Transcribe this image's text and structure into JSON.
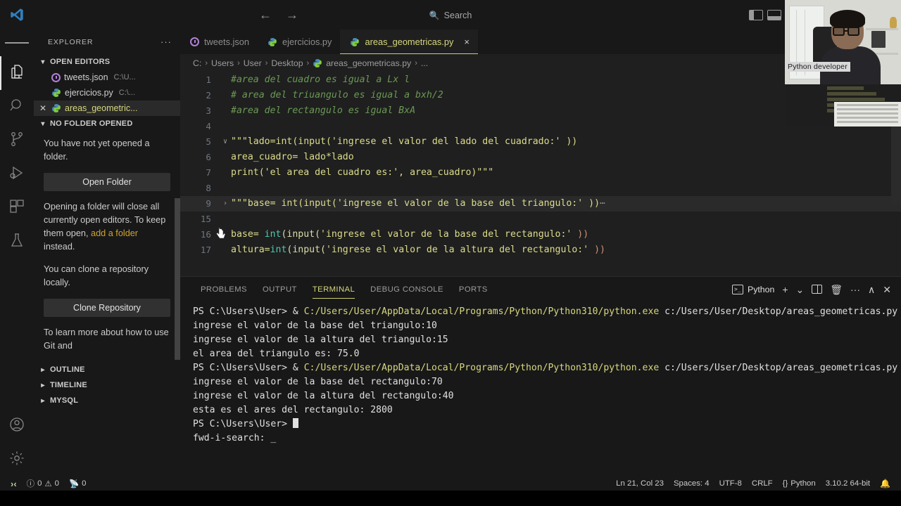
{
  "titlebar": {
    "back_label": "←",
    "forward_label": "→",
    "search_placeholder": "Search",
    "search_icon": "search-icon"
  },
  "activitybar": {
    "items": [
      {
        "name": "explorer",
        "icon": "files-icon",
        "active": true
      },
      {
        "name": "search",
        "icon": "search-icon",
        "active": false
      },
      {
        "name": "source-control",
        "icon": "source-control-icon",
        "active": false
      },
      {
        "name": "run-and-debug",
        "icon": "run-debug-icon",
        "active": false
      },
      {
        "name": "extensions",
        "icon": "extensions-icon",
        "active": false
      },
      {
        "name": "testing",
        "icon": "beaker-icon",
        "active": false
      }
    ],
    "bottom": [
      {
        "name": "accounts",
        "icon": "account-icon"
      },
      {
        "name": "settings",
        "icon": "gear-icon"
      }
    ]
  },
  "sidebar": {
    "title": "EXPLORER",
    "more_actions": "···",
    "open_editors": {
      "label": "OPEN EDITORS",
      "files": [
        {
          "name": "tweets.json",
          "path": "C:\\U...",
          "icon": "json-icon",
          "active": false
        },
        {
          "name": "ejercicios.py",
          "path": "C:\\...",
          "icon": "python-icon",
          "active": false
        },
        {
          "name": "areas_geometric...",
          "path": "",
          "icon": "python-icon",
          "active": true
        }
      ]
    },
    "no_folder": {
      "label": "NO FOLDER OPENED",
      "message_1": "You have not yet opened a folder.",
      "open_folder_button": "Open Folder",
      "message_2_pre": "Opening a folder will close all currently open editors. To keep them open, ",
      "message_2_link": "add a folder",
      "message_2_post": " instead.",
      "message_3": "You can clone a repository locally.",
      "clone_button": "Clone Repository",
      "message_4": "To learn more about how to use Git and"
    },
    "sections": [
      {
        "label": "OUTLINE"
      },
      {
        "label": "TIMELINE"
      },
      {
        "label": "MYSQL"
      }
    ]
  },
  "editor": {
    "tabs": [
      {
        "label": "tweets.json",
        "icon": "json-icon",
        "active": false,
        "closable": false
      },
      {
        "label": "ejercicios.py",
        "icon": "python-icon",
        "active": false,
        "closable": false
      },
      {
        "label": "areas_geometricas.py",
        "icon": "python-icon",
        "active": true,
        "closable": true,
        "close_label": "×"
      }
    ],
    "breadcrumb": [
      "C:",
      "Users",
      "User",
      "Desktop",
      "areas_geometricas.py",
      "..."
    ],
    "lines": [
      {
        "num": "1",
        "fold": "",
        "highlight": false,
        "tokens": [
          {
            "t": "#area del cuadro es igual a Lx l",
            "c": "cm"
          }
        ]
      },
      {
        "num": "2",
        "fold": "",
        "highlight": false,
        "tokens": [
          {
            "t": "# area del triuangulo es igual a bxh/2",
            "c": "cm"
          }
        ]
      },
      {
        "num": "3",
        "fold": "",
        "highlight": false,
        "tokens": [
          {
            "t": "#area del rectangulo es igual BxA",
            "c": "cm"
          }
        ]
      },
      {
        "num": "4",
        "fold": "",
        "highlight": false,
        "tokens": [
          {
            "t": "",
            "c": ""
          }
        ]
      },
      {
        "num": "5",
        "fold": "∨",
        "highlight": false,
        "tokens": [
          {
            "t": "\"\"\"lado=int(input('ingrese el valor del lado del cuadrado:' ))",
            "c": "yel"
          }
        ]
      },
      {
        "num": "6",
        "fold": "",
        "highlight": false,
        "tokens": [
          {
            "t": "area_cuadro= lado*lado",
            "c": "yel"
          }
        ]
      },
      {
        "num": "7",
        "fold": "",
        "highlight": false,
        "tokens": [
          {
            "t": "print('el area del cuadro es:', area_cuadro)\"\"\"",
            "c": "yel"
          }
        ]
      },
      {
        "num": "8",
        "fold": "",
        "highlight": false,
        "tokens": [
          {
            "t": "",
            "c": ""
          }
        ]
      },
      {
        "num": "9",
        "fold": "›",
        "highlight": true,
        "tokens": [
          {
            "t": "\"\"\"base= int(input('ingrese el valor de la base del triangulo:' ))",
            "c": "yel"
          },
          {
            "t": "⋯",
            "c": "dots3"
          }
        ]
      },
      {
        "num": "15",
        "fold": "",
        "highlight": false,
        "tokens": [
          {
            "t": "",
            "c": ""
          }
        ]
      },
      {
        "num": "16",
        "fold": "",
        "highlight": false,
        "tokens": [
          {
            "t": "base= ",
            "c": "yel"
          },
          {
            "t": "int",
            "c": "kw"
          },
          {
            "t": "(input(",
            "c": "pl"
          },
          {
            "t": "'ingrese el valor de la base del rectangulo:'",
            "c": "yel"
          },
          {
            "t": " ))",
            "c": "str"
          }
        ]
      },
      {
        "num": "17",
        "fold": "",
        "highlight": false,
        "tokens": [
          {
            "t": "altura=",
            "c": "yel"
          },
          {
            "t": "int",
            "c": "kw"
          },
          {
            "t": "(input(",
            "c": "pl"
          },
          {
            "t": "'ingrese el valor de la altura del rectangulo:'",
            "c": "yel"
          },
          {
            "t": " ))",
            "c": "str"
          }
        ]
      }
    ]
  },
  "panel": {
    "tabs": [
      {
        "label": "PROBLEMS",
        "active": false
      },
      {
        "label": "OUTPUT",
        "active": false
      },
      {
        "label": "TERMINAL",
        "active": true
      },
      {
        "label": "DEBUG CONSOLE",
        "active": false
      },
      {
        "label": "PORTS",
        "active": false
      }
    ],
    "shell_name": "Python",
    "actions": [
      {
        "name": "new-terminal-button",
        "glyph": "+"
      },
      {
        "name": "terminal-dropdown-button",
        "glyph": "⌄"
      },
      {
        "name": "split-terminal-button",
        "glyph": "split"
      },
      {
        "name": "kill-terminal-button",
        "glyph": "🗑"
      },
      {
        "name": "more-actions-button",
        "glyph": "···"
      },
      {
        "name": "maximize-panel-button",
        "glyph": "∧"
      },
      {
        "name": "close-panel-button",
        "glyph": "✕"
      }
    ],
    "terminal_lines": [
      [
        {
          "t": "PS C:\\Users\\User> ",
          "c": "t-white"
        },
        {
          "t": "& ",
          "c": "t-white"
        },
        {
          "t": "C:/Users/User/AppData/Local/Programs/Python/Python310/python.exe",
          "c": "t-yellow"
        },
        {
          "t": " c:/Users/User/Desktop/areas_geometricas.py",
          "c": "t-white"
        }
      ],
      [
        {
          "t": "ingrese el valor de la base del triangulo:10",
          "c": "t-white"
        }
      ],
      [
        {
          "t": "ingrese el valor de la altura del triangulo:15",
          "c": "t-white"
        }
      ],
      [
        {
          "t": "el area del triangulo es: 75.0",
          "c": "t-white"
        }
      ],
      [
        {
          "t": "PS C:\\Users\\User> ",
          "c": "t-white"
        },
        {
          "t": "& ",
          "c": "t-white"
        },
        {
          "t": "C:/Users/User/AppData/Local/Programs/Python/Python310/python.exe",
          "c": "t-yellow"
        },
        {
          "t": " c:/Users/User/Desktop/areas_geometricas.py",
          "c": "t-white"
        }
      ],
      [
        {
          "t": "ingrese el valor de la base del rectangulo:70",
          "c": "t-white"
        }
      ],
      [
        {
          "t": "ingrese el valor de la altura del rectangulo:40",
          "c": "t-white"
        }
      ],
      [
        {
          "t": "esta es el ares del rectangulo: 2800",
          "c": "t-white"
        }
      ],
      [
        {
          "t": "PS C:\\Users\\User> ",
          "c": "t-white"
        },
        {
          "t": "CURSOR",
          "c": "cursor"
        }
      ],
      [
        {
          "t": "fwd-i-search: _",
          "c": "t-white"
        }
      ]
    ]
  },
  "statusbar": {
    "remote_icon": "remote-indicator-icon",
    "errors": "0",
    "warnings": "0",
    "ports": "0",
    "cursor_position": "Ln 21, Col 23",
    "indentation": "Spaces: 4",
    "encoding": "UTF-8",
    "eol": "CRLF",
    "language": "Python",
    "interpreter": "3.10.2 64-bit",
    "notifications_icon": "bell-icon"
  },
  "webcam": {
    "label": "Python developer"
  }
}
